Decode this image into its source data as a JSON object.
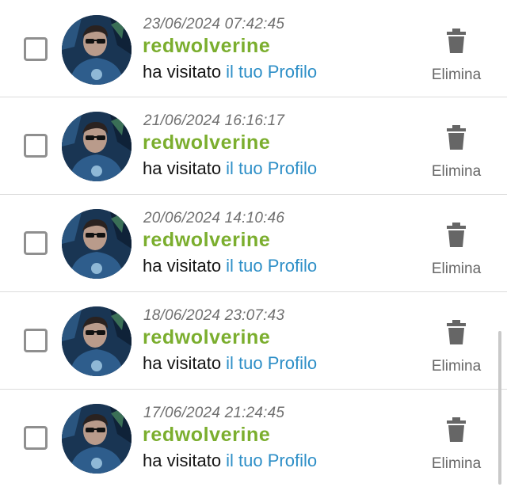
{
  "colors": {
    "username": "#7bae2e",
    "link": "#2e8fc7",
    "timestamp": "#6f6f6f",
    "delete": "#666666",
    "divider": "#dcdcdc"
  },
  "icons": {
    "delete": "trash-icon",
    "checkbox": "checkbox-icon"
  },
  "visits": [
    {
      "timestamp": "23/06/2024 07:42:45",
      "username": "redwolverine",
      "action_text": "ha visitato ",
      "link_text": "il tuo Profilo",
      "delete_label": "Elimina",
      "checked": false
    },
    {
      "timestamp": "21/06/2024 16:16:17",
      "username": "redwolverine",
      "action_text": "ha visitato ",
      "link_text": "il tuo Profilo",
      "delete_label": "Elimina",
      "checked": false
    },
    {
      "timestamp": "20/06/2024 14:10:46",
      "username": "redwolverine",
      "action_text": "ha visitato ",
      "link_text": "il tuo Profilo",
      "delete_label": "Elimina",
      "checked": false
    },
    {
      "timestamp": "18/06/2024 23:07:43",
      "username": "redwolverine",
      "action_text": "ha visitato ",
      "link_text": "il tuo Profilo",
      "delete_label": "Elimina",
      "checked": false
    },
    {
      "timestamp": "17/06/2024 21:24:45",
      "username": "redwolverine",
      "action_text": "ha visitato ",
      "link_text": "il tuo Profilo",
      "delete_label": "Elimina",
      "checked": false
    }
  ]
}
